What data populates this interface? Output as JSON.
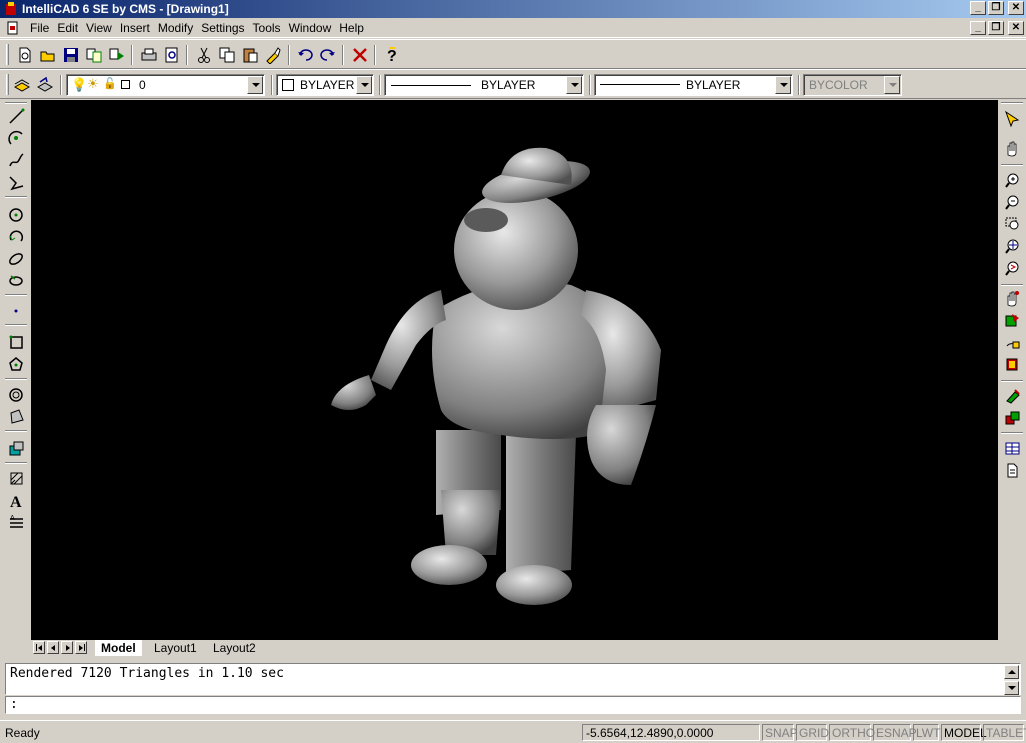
{
  "title": "IntelliCAD 6 SE by CMS - [Drawing1]",
  "menu": [
    "File",
    "Edit",
    "View",
    "Insert",
    "Modify",
    "Settings",
    "Tools",
    "Window",
    "Help"
  ],
  "toolbar2": {
    "layer_value": "0",
    "color_value": "BYLAYER",
    "linetype_value": "BYLAYER",
    "lineweight_value": "BYLAYER",
    "plotstyle_value": "BYCOLOR"
  },
  "tabs": [
    "Model",
    "Layout1",
    "Layout2"
  ],
  "active_tab": "Model",
  "command": {
    "history": "Rendered 7120 Triangles in 1.10 sec",
    "prompt": ":"
  },
  "status": {
    "ready": "Ready",
    "coords": "-5.6564,12.4890,0.0000",
    "toggles": [
      "SNAP",
      "GRID",
      "ORTHO",
      "ESNAP",
      "LWT",
      "MODEL",
      "TABLET"
    ],
    "active_toggle": "MODEL"
  },
  "icons": {
    "standard_toolbar": [
      "new-icon",
      "open-icon",
      "save-icon",
      "cut-icon",
      "copy-icon",
      "print-icon",
      "print-preview-icon",
      "scissors-icon",
      "copy-clip-icon",
      "paste-icon",
      "match-properties-icon",
      "undo-icon",
      "redo-icon",
      "cancel-icon",
      "help-icon"
    ],
    "draw_toolbar": [
      "line-icon",
      "arc-icon",
      "spline-icon",
      "polyline-icon",
      "circle-icon",
      "revcloud-icon",
      "ellipse-icon",
      "donut-icon",
      "point-icon",
      "rectangle-icon",
      "polygon-icon",
      "ring-icon",
      "region-icon",
      "block-icon",
      "hatch-icon",
      "text-icon",
      "mtext-icon"
    ],
    "view_toolbar": [
      "pick-icon",
      "pan-hand-icon",
      "zoom-in-icon",
      "zoom-out-icon",
      "zoom-window-icon",
      "zoom-extents-icon",
      "zoom-previous-icon",
      "realtime-pan-icon",
      "named-views-icon",
      "viewports-icon",
      "3d-view-icon",
      "shade-icon",
      "render-icon",
      "table-icon",
      "doc-icon"
    ]
  }
}
